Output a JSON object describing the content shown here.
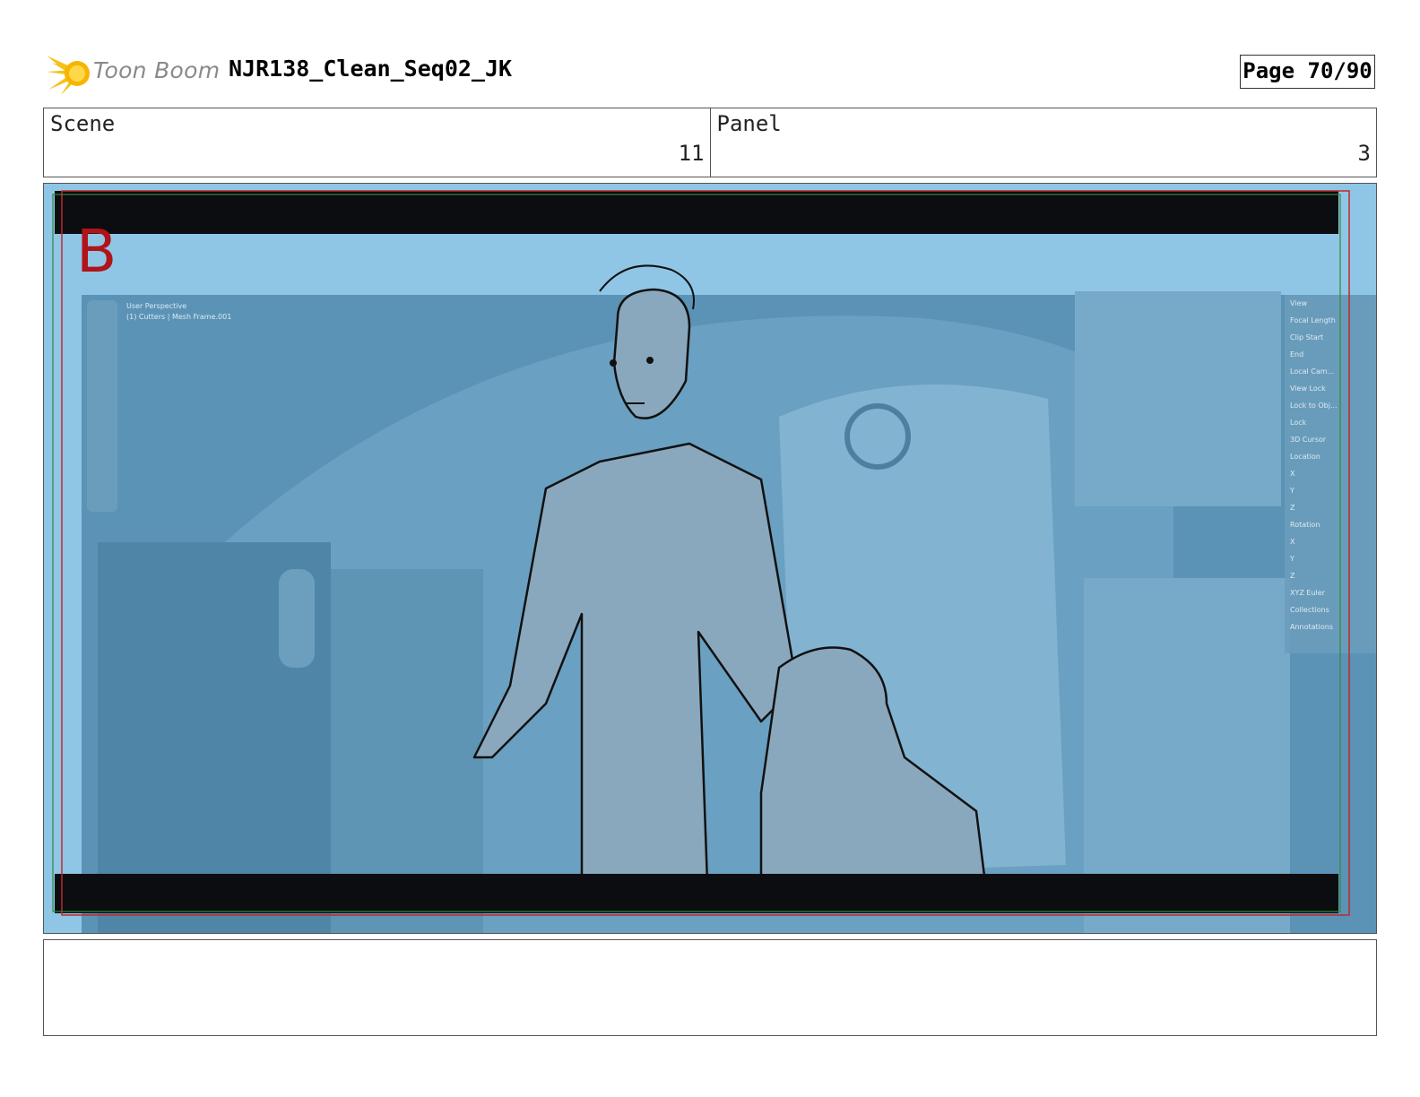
{
  "header": {
    "logo_text": "Toon Boom",
    "document_title": "NJR138_Clean_Seq02_JK",
    "page_indicator": "Page 70/90"
  },
  "info": {
    "scene_label": "Scene",
    "scene_value": "11",
    "panel_label": "Panel",
    "panel_value": "3"
  },
  "panel": {
    "marker": "B",
    "viewport_text": {
      "perspective": "User Perspective",
      "object": "(1) Cutters | Mesh Frame.001",
      "panel_items": [
        "View",
        "Focal Length",
        "Clip Start",
        "End",
        "Local Cam...",
        "View Lock",
        "Lock to Obj...",
        "Lock",
        "3D Cursor",
        "Location",
        "X",
        "Y",
        "Z",
        "Rotation",
        "X",
        "Y",
        "Z",
        "XYZ Euler",
        "Collections",
        "Annotations"
      ]
    }
  },
  "colors": {
    "marker_red": "#b0141a",
    "panel_blue": "#8fc6e6",
    "viewport_blue": "#5b93b6",
    "safe_frame_red": "#c0282e",
    "safe_frame_green": "#2e8b3a"
  },
  "notes": ""
}
